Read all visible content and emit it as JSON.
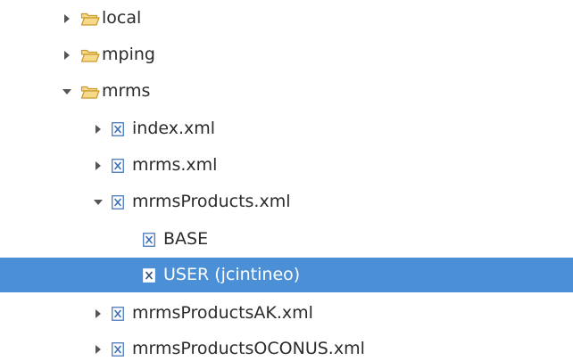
{
  "tree": {
    "items": [
      {
        "label": "local",
        "kind": "folder",
        "expanded": false,
        "has_children": true,
        "depth": 0,
        "selected": false
      },
      {
        "label": "mping",
        "kind": "folder",
        "expanded": false,
        "has_children": true,
        "depth": 0,
        "selected": false
      },
      {
        "label": "mrms",
        "kind": "folder",
        "expanded": true,
        "has_children": true,
        "depth": 0,
        "selected": false
      },
      {
        "label": "index.xml",
        "kind": "xml-file",
        "expanded": false,
        "has_children": true,
        "depth": 1,
        "selected": false
      },
      {
        "label": "mrms.xml",
        "kind": "xml-file",
        "expanded": false,
        "has_children": true,
        "depth": 1,
        "selected": false
      },
      {
        "label": "mrmsProducts.xml",
        "kind": "xml-file",
        "expanded": true,
        "has_children": true,
        "depth": 1,
        "selected": false
      },
      {
        "label": "BASE",
        "kind": "xml-file",
        "expanded": false,
        "has_children": false,
        "depth": 2,
        "selected": false
      },
      {
        "label": "USER (jcintineo)",
        "kind": "xml-file",
        "expanded": false,
        "has_children": false,
        "depth": 2,
        "selected": true
      },
      {
        "label": "mrmsProductsAK.xml",
        "kind": "xml-file",
        "expanded": false,
        "has_children": true,
        "depth": 1,
        "selected": false
      },
      {
        "label": "mrmsProductsOCONUS.xml",
        "kind": "xml-file",
        "expanded": false,
        "has_children": true,
        "depth": 1,
        "selected": false
      }
    ]
  },
  "colors": {
    "selection_bg": "#4b8fd6",
    "text": "#2b2b2b",
    "selected_text": "#ffffff",
    "folder_fill": "#f6d98a",
    "folder_stroke": "#c99a2c",
    "xml_icon_stroke": "#3a6fb5"
  },
  "icons": {
    "collapsed": "triangle-right-icon",
    "expanded": "triangle-down-icon",
    "folder": "open-folder-icon",
    "xml_file": "xml-file-icon"
  }
}
